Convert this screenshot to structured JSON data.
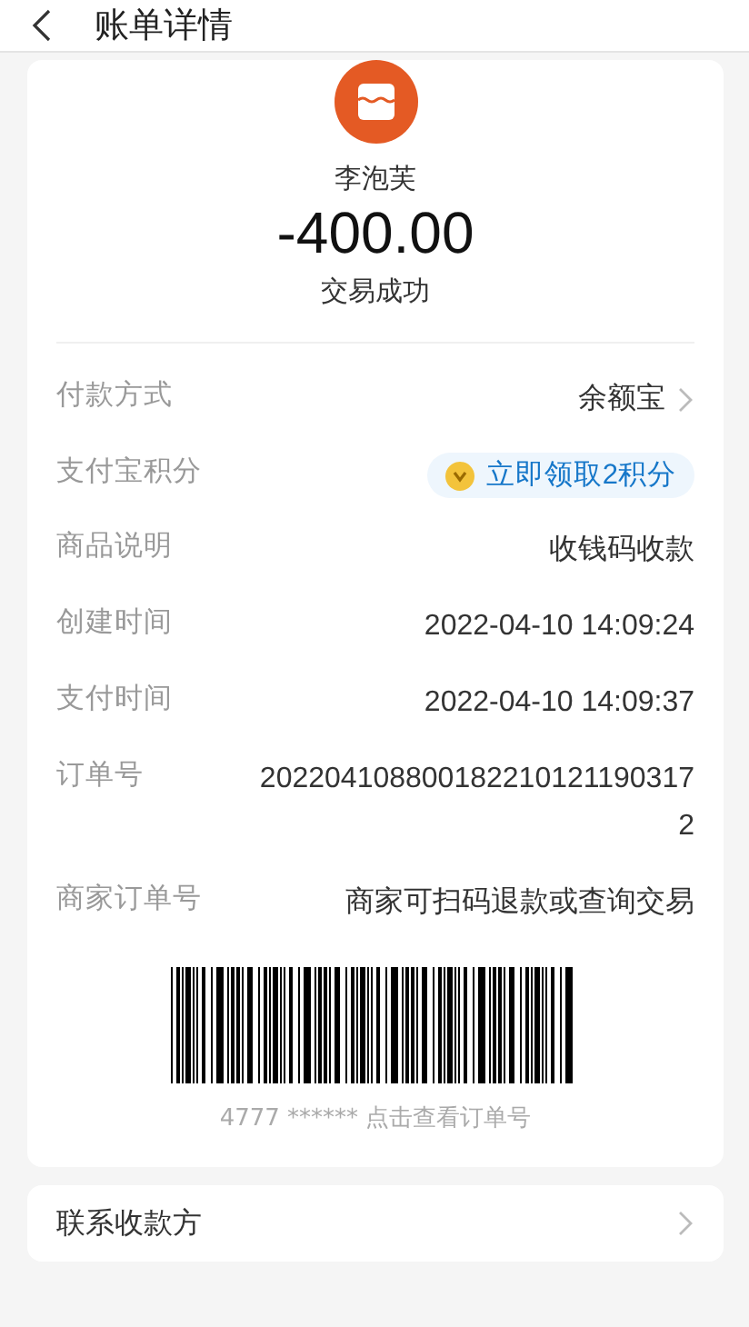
{
  "header": {
    "title": "账单详情"
  },
  "merchant": {
    "name": "李泡芙"
  },
  "amount": "-400.00",
  "status": "交易成功",
  "details": [
    {
      "kind": "link",
      "label": "付款方式",
      "value": "余额宝"
    },
    {
      "kind": "reward",
      "label": "支付宝积分",
      "value": "立即领取2积分"
    },
    {
      "kind": "plain",
      "label": "商品说明",
      "value": "收钱码收款"
    },
    {
      "kind": "plain",
      "label": "创建时间",
      "value": "2022-04-10 14:09:24"
    },
    {
      "kind": "plain",
      "label": "支付时间",
      "value": "2022-04-10 14:09:37"
    },
    {
      "kind": "plain",
      "label": "订单号",
      "value": "2022041088001822101211903172"
    },
    {
      "kind": "plain",
      "label": "商家订单号",
      "value": "商家可扫码退款或查询交易"
    }
  ],
  "barcode": {
    "caption": "4777 ****** 点击查看订单号"
  },
  "contact": {
    "label": "联系收款方"
  }
}
